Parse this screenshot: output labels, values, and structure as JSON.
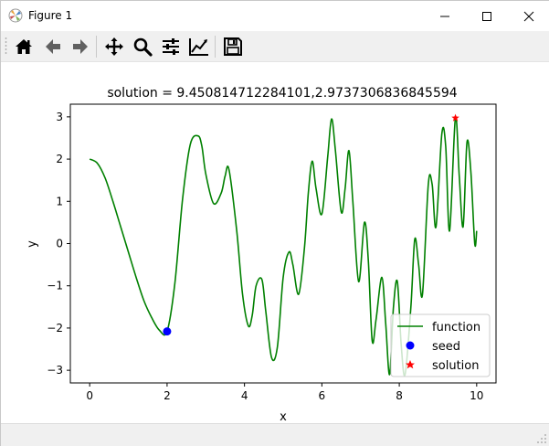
{
  "window": {
    "title": "Figure 1"
  },
  "toolbar": {
    "buttons": [
      "home-icon",
      "back-arrow-icon",
      "forward-arrow-icon",
      "pan-icon",
      "zoom-icon",
      "configure-subplots-icon",
      "edit-axis-icon",
      "save-icon"
    ]
  },
  "colors": {
    "function_line": "#008000",
    "seed_marker": "#0000ff",
    "solution_marker": "#ff0000",
    "toolbar_bg": "#f0f0f0"
  },
  "chart_data": {
    "type": "line",
    "title": "solution = 9.450814712284101,2.9737306836845594",
    "xlabel": "x",
    "ylabel": "y",
    "xlim": [
      -0.5,
      10.5
    ],
    "ylim": [
      -3.3,
      3.3
    ],
    "xticks": [
      "0",
      "2",
      "4",
      "6",
      "8",
      "10"
    ],
    "yticks": [
      "−3",
      "−2",
      "−1",
      "0",
      "1",
      "2",
      "3"
    ],
    "legend": {
      "position": "lower-right",
      "entries": [
        "function",
        "seed",
        "solution"
      ]
    },
    "series": [
      {
        "name": "function",
        "style": "line",
        "x": [
          0.0,
          0.2,
          0.4,
          0.6,
          0.8,
          1.0,
          1.2,
          1.4,
          1.6,
          1.8,
          2.0,
          2.2,
          2.4,
          2.6,
          2.8,
          2.9,
          3.0,
          3.2,
          3.4,
          3.5,
          3.6,
          3.8,
          3.95,
          4.1,
          4.2,
          4.3,
          4.45,
          4.55,
          4.7,
          4.85,
          5.0,
          5.15,
          5.25,
          5.4,
          5.55,
          5.65,
          5.75,
          5.85,
          6.0,
          6.15,
          6.25,
          6.35,
          6.5,
          6.6,
          6.7,
          6.8,
          6.95,
          7.1,
          7.2,
          7.3,
          7.4,
          7.55,
          7.65,
          7.75,
          7.85,
          7.95,
          8.05,
          8.15,
          8.3,
          8.4,
          8.5,
          8.6,
          8.75,
          8.85,
          8.95,
          9.1,
          9.2,
          9.3,
          9.45,
          9.55,
          9.65,
          9.75,
          9.85,
          9.95,
          10.0
        ],
        "y": [
          2.0,
          1.9,
          1.55,
          1.0,
          0.4,
          -0.2,
          -0.8,
          -1.35,
          -1.75,
          -2.05,
          -2.08,
          -0.95,
          1.05,
          2.35,
          2.55,
          2.3,
          1.65,
          0.95,
          1.2,
          1.6,
          1.75,
          0.3,
          -1.2,
          -1.95,
          -1.7,
          -1.0,
          -0.85,
          -1.6,
          -2.7,
          -2.45,
          -0.8,
          -0.2,
          -0.5,
          -1.2,
          -0.1,
          1.2,
          1.95,
          1.3,
          0.7,
          2.05,
          2.95,
          2.2,
          0.75,
          1.3,
          2.2,
          1.0,
          -0.9,
          0.5,
          -0.4,
          -2.3,
          -1.8,
          -0.8,
          -1.9,
          -3.1,
          -1.5,
          -0.9,
          -2.4,
          -3.1,
          -1.5,
          0.1,
          -0.5,
          -1.2,
          1.4,
          1.4,
          0.4,
          2.6,
          2.3,
          0.3,
          2.97,
          1.6,
          0.4,
          2.4,
          1.7,
          0.0,
          0.3
        ]
      },
      {
        "name": "seed",
        "style": "marker-circle",
        "x": [
          2.0
        ],
        "y": [
          -2.08
        ]
      },
      {
        "name": "solution",
        "style": "marker-star",
        "x": [
          9.4508
        ],
        "y": [
          2.9737
        ]
      }
    ]
  }
}
